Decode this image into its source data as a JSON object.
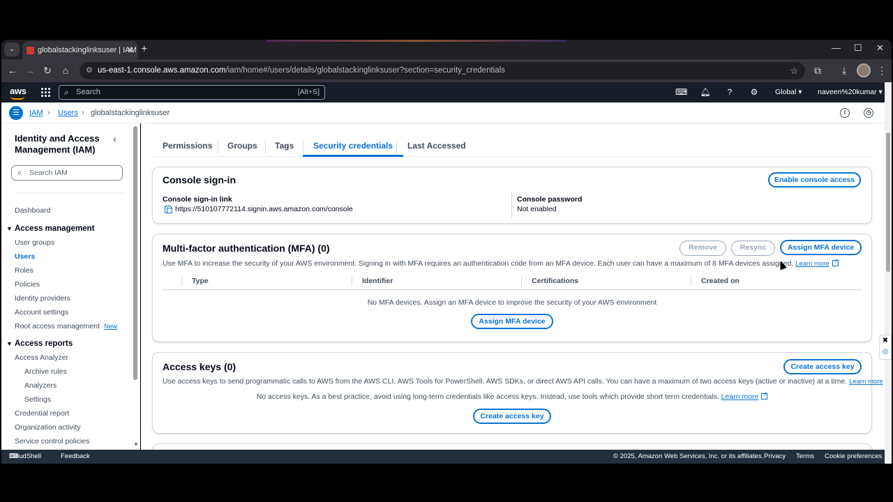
{
  "browser": {
    "tab_title": "globalstackinglinksuser | IAM |",
    "url_host": "us-east-1.console.aws.amazon.com",
    "url_path": "/iam/home#/users/details/globalstackinglinksuser?section=security_credentials"
  },
  "aws_header": {
    "logo": "aws",
    "search_placeholder": "Search",
    "search_shortcut": "[Alt+S]",
    "region": "Global",
    "account": "naveen%20kumar"
  },
  "breadcrumb": {
    "items": [
      "IAM",
      "Users"
    ],
    "current": "globalstackinglinksuser"
  },
  "sidebar": {
    "title": "Identity and Access Management (IAM)",
    "search_placeholder": "Search IAM",
    "dashboard": "Dashboard",
    "section1": "Access management",
    "access_items": [
      "User groups",
      "Users",
      "Roles",
      "Policies",
      "Identity providers",
      "Account settings",
      "Root access management"
    ],
    "new_badge": "New",
    "section2": "Access reports",
    "report_items": [
      "Access Analyzer",
      "Archive rules",
      "Analyzers",
      "Settings",
      "Credential report",
      "Organization activity",
      "Service control policies"
    ]
  },
  "tabs": [
    "Permissions",
    "Groups",
    "Tags",
    "Security credentials",
    "Last Accessed"
  ],
  "console_signin": {
    "title": "Console sign-in",
    "enable_button": "Enable console access",
    "link_label": "Console sign-in link",
    "link_value": "https://510107772114.signin.aws.amazon.com/console",
    "password_label": "Console password",
    "password_value": "Not enabled"
  },
  "mfa": {
    "title": "Multi-factor authentication (MFA) (0)",
    "remove_button": "Remove",
    "resync_button": "Resync",
    "assign_button": "Assign MFA device",
    "description": "Use MFA to increase the security of your AWS environment. Signing in with MFA requires an authentication code from an MFA device. Each user can have a maximum of 8 MFA devices assigned.",
    "learn_more": "Learn more",
    "columns": [
      "Type",
      "Identifier",
      "Certifications",
      "Created on"
    ],
    "empty_text": "No MFA devices. Assign an MFA device to improve the security of your AWS environment",
    "empty_button": "Assign MFA device"
  },
  "access_keys": {
    "title": "Access keys (0)",
    "create_button": "Create access key",
    "description": "Use access keys to send programmatic calls to AWS from the AWS CLI, AWS Tools for PowerShell, AWS SDKs, or direct AWS API calls. You can have a maximum of two access keys (active or inactive) at a time.",
    "learn_more": "Learn more",
    "empty_text": "No access keys. As a best practice, avoid using long-term credentials like access keys. Instead, use tools which provide short term credentials.",
    "empty_learn_more": "Learn more",
    "empty_button": "Create access key"
  },
  "footer": {
    "cloudshell": "CloudShell",
    "feedback": "Feedback",
    "copyright": "© 2025, Amazon Web Services, Inc. or its affiliates.",
    "privacy": "Privacy",
    "terms": "Terms",
    "cookie": "Cookie preferences"
  },
  "colors": {
    "accent": "#0972d3",
    "header_bg": "#161d26",
    "footer_bg": "#232f3e"
  }
}
